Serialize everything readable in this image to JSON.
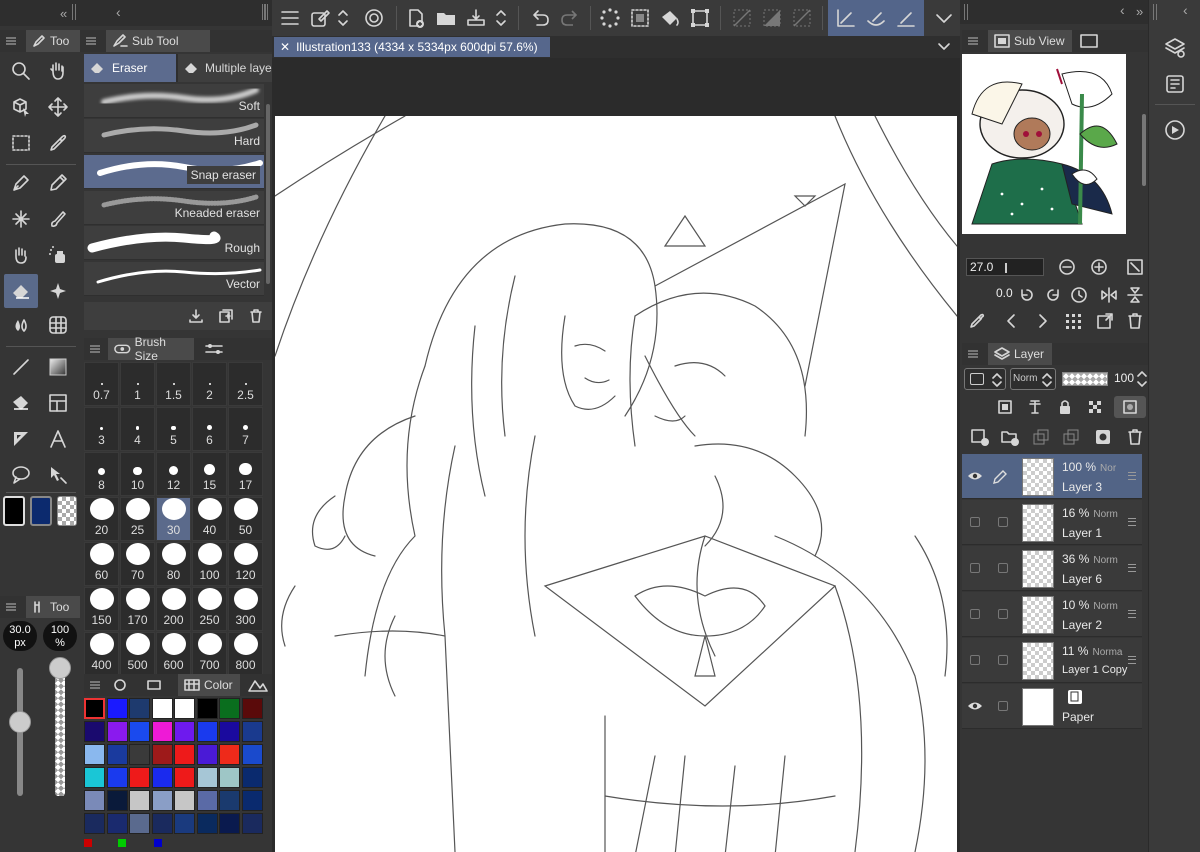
{
  "tool_panel": {
    "title": "Too"
  },
  "tool_property_panel": {
    "title": "Too",
    "size_value": "30.0",
    "size_unit": "px",
    "opacity_value": "100",
    "opacity_unit": "%"
  },
  "subtool": {
    "title": "Sub Tool",
    "tabs": [
      "Eraser",
      "Multiple laye"
    ],
    "brushes": [
      "Soft",
      "Hard",
      "Snap eraser",
      "Kneaded eraser",
      "Rough",
      "Vector"
    ],
    "selected": "Snap eraser"
  },
  "brush_size": {
    "title": "Brush Size",
    "sizes": [
      "0.7",
      "1",
      "1.5",
      "2",
      "2.5",
      "3",
      "4",
      "5",
      "6",
      "7",
      "8",
      "10",
      "12",
      "15",
      "17",
      "20",
      "25",
      "30",
      "40",
      "50",
      "60",
      "70",
      "80",
      "100",
      "120",
      "150",
      "170",
      "200",
      "250",
      "300",
      "400",
      "500",
      "600",
      "700",
      "800"
    ],
    "selected": "30"
  },
  "color_panel": {
    "title": "Color"
  },
  "colors": {
    "main": "#000000",
    "sub": "#0c2a6e",
    "swatches": [
      "#000000",
      "#1a1aff",
      "#1e3a6e",
      "#ffffff",
      "#ffffff",
      "#000000",
      "#0a6e1e",
      "#5a0a0a",
      "#1a0a6e",
      "#8a1aee",
      "#1a4aee",
      "#ee1ad6",
      "#6e1aee",
      "#1a3aee",
      "#1a0a9e",
      "#1a3a8e",
      "#8ab8ee",
      "#1a3a9e",
      "#3a3a3a",
      "#9e1a1a",
      "#ee1a1a",
      "#4a1ad6",
      "#ee2a1a",
      "#1a4acc",
      "#1ac6d6",
      "#1a3aee",
      "#ee1a1a",
      "#1a2aee",
      "#ee1a1a",
      "#a6c6d6",
      "#9ec6c6",
      "#0a2a6e",
      "#7a8ab8",
      "#0a1a3a",
      "#c6c6c6",
      "#8a9ec6",
      "#c6c6c6",
      "#5a6aa6",
      "#1a3a6e",
      "#0a2a6e",
      "#1a2a5e",
      "#1a2a6e",
      "#5a6a8e",
      "#1a2a5e",
      "#1a3a7e",
      "#0a2a5e",
      "#0a1a4e",
      "#1a2a5e"
    ]
  },
  "document": {
    "tab_title": "Illustration133 (4334 x 5334px 600dpi 57.6%)"
  },
  "subview": {
    "title": "Sub View",
    "zoom": "27.0",
    "rotation": "0.0"
  },
  "layer_panel": {
    "title": "Layer",
    "blend_mode": "Norm",
    "opacity": "100",
    "layers": [
      {
        "opacity": "100 %",
        "mode": "Nor",
        "name": "Layer 3",
        "visible": true,
        "selected": true
      },
      {
        "opacity": "16 %",
        "mode": "Norm",
        "name": "Layer 1",
        "visible": false,
        "selected": false
      },
      {
        "opacity": "36 %",
        "mode": "Norm",
        "name": "Layer 6",
        "visible": false,
        "selected": false
      },
      {
        "opacity": "10 %",
        "mode": "Norm",
        "name": "Layer 2",
        "visible": false,
        "selected": false
      },
      {
        "opacity": "11 %",
        "mode": "Norma",
        "name": "Layer 1 Copy",
        "visible": false,
        "selected": false
      },
      {
        "opacity": "",
        "mode": "",
        "name": "Paper",
        "visible": true,
        "selected": false
      }
    ]
  }
}
